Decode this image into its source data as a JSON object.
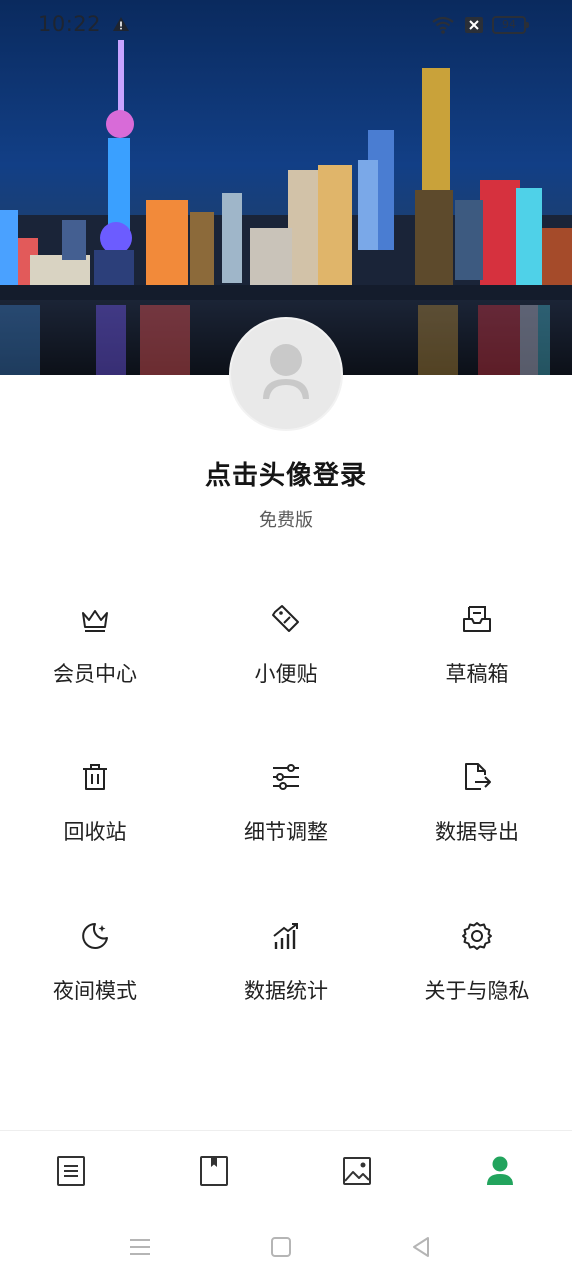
{
  "status_bar": {
    "time": "10:22",
    "battery": "94"
  },
  "profile": {
    "login_prompt": "点击头像登录",
    "plan": "免费版"
  },
  "menu": {
    "items": [
      {
        "label": "会员中心",
        "icon": "crown-icon"
      },
      {
        "label": "小便贴",
        "icon": "tag-icon"
      },
      {
        "label": "草稿箱",
        "icon": "inbox-tray-icon"
      },
      {
        "label": "回收站",
        "icon": "trash-icon"
      },
      {
        "label": "细节调整",
        "icon": "sliders-icon"
      },
      {
        "label": "数据导出",
        "icon": "file-export-icon"
      },
      {
        "label": "夜间模式",
        "icon": "moon-icon"
      },
      {
        "label": "数据统计",
        "icon": "chart-up-icon"
      },
      {
        "label": "关于与隐私",
        "icon": "gear-icon"
      }
    ]
  },
  "tabbar": {
    "tabs": [
      {
        "icon": "document-icon",
        "active": false
      },
      {
        "icon": "book-icon",
        "active": false
      },
      {
        "icon": "image-icon",
        "active": false
      },
      {
        "icon": "user-icon",
        "active": true
      }
    ],
    "accent": "#22a45d"
  }
}
